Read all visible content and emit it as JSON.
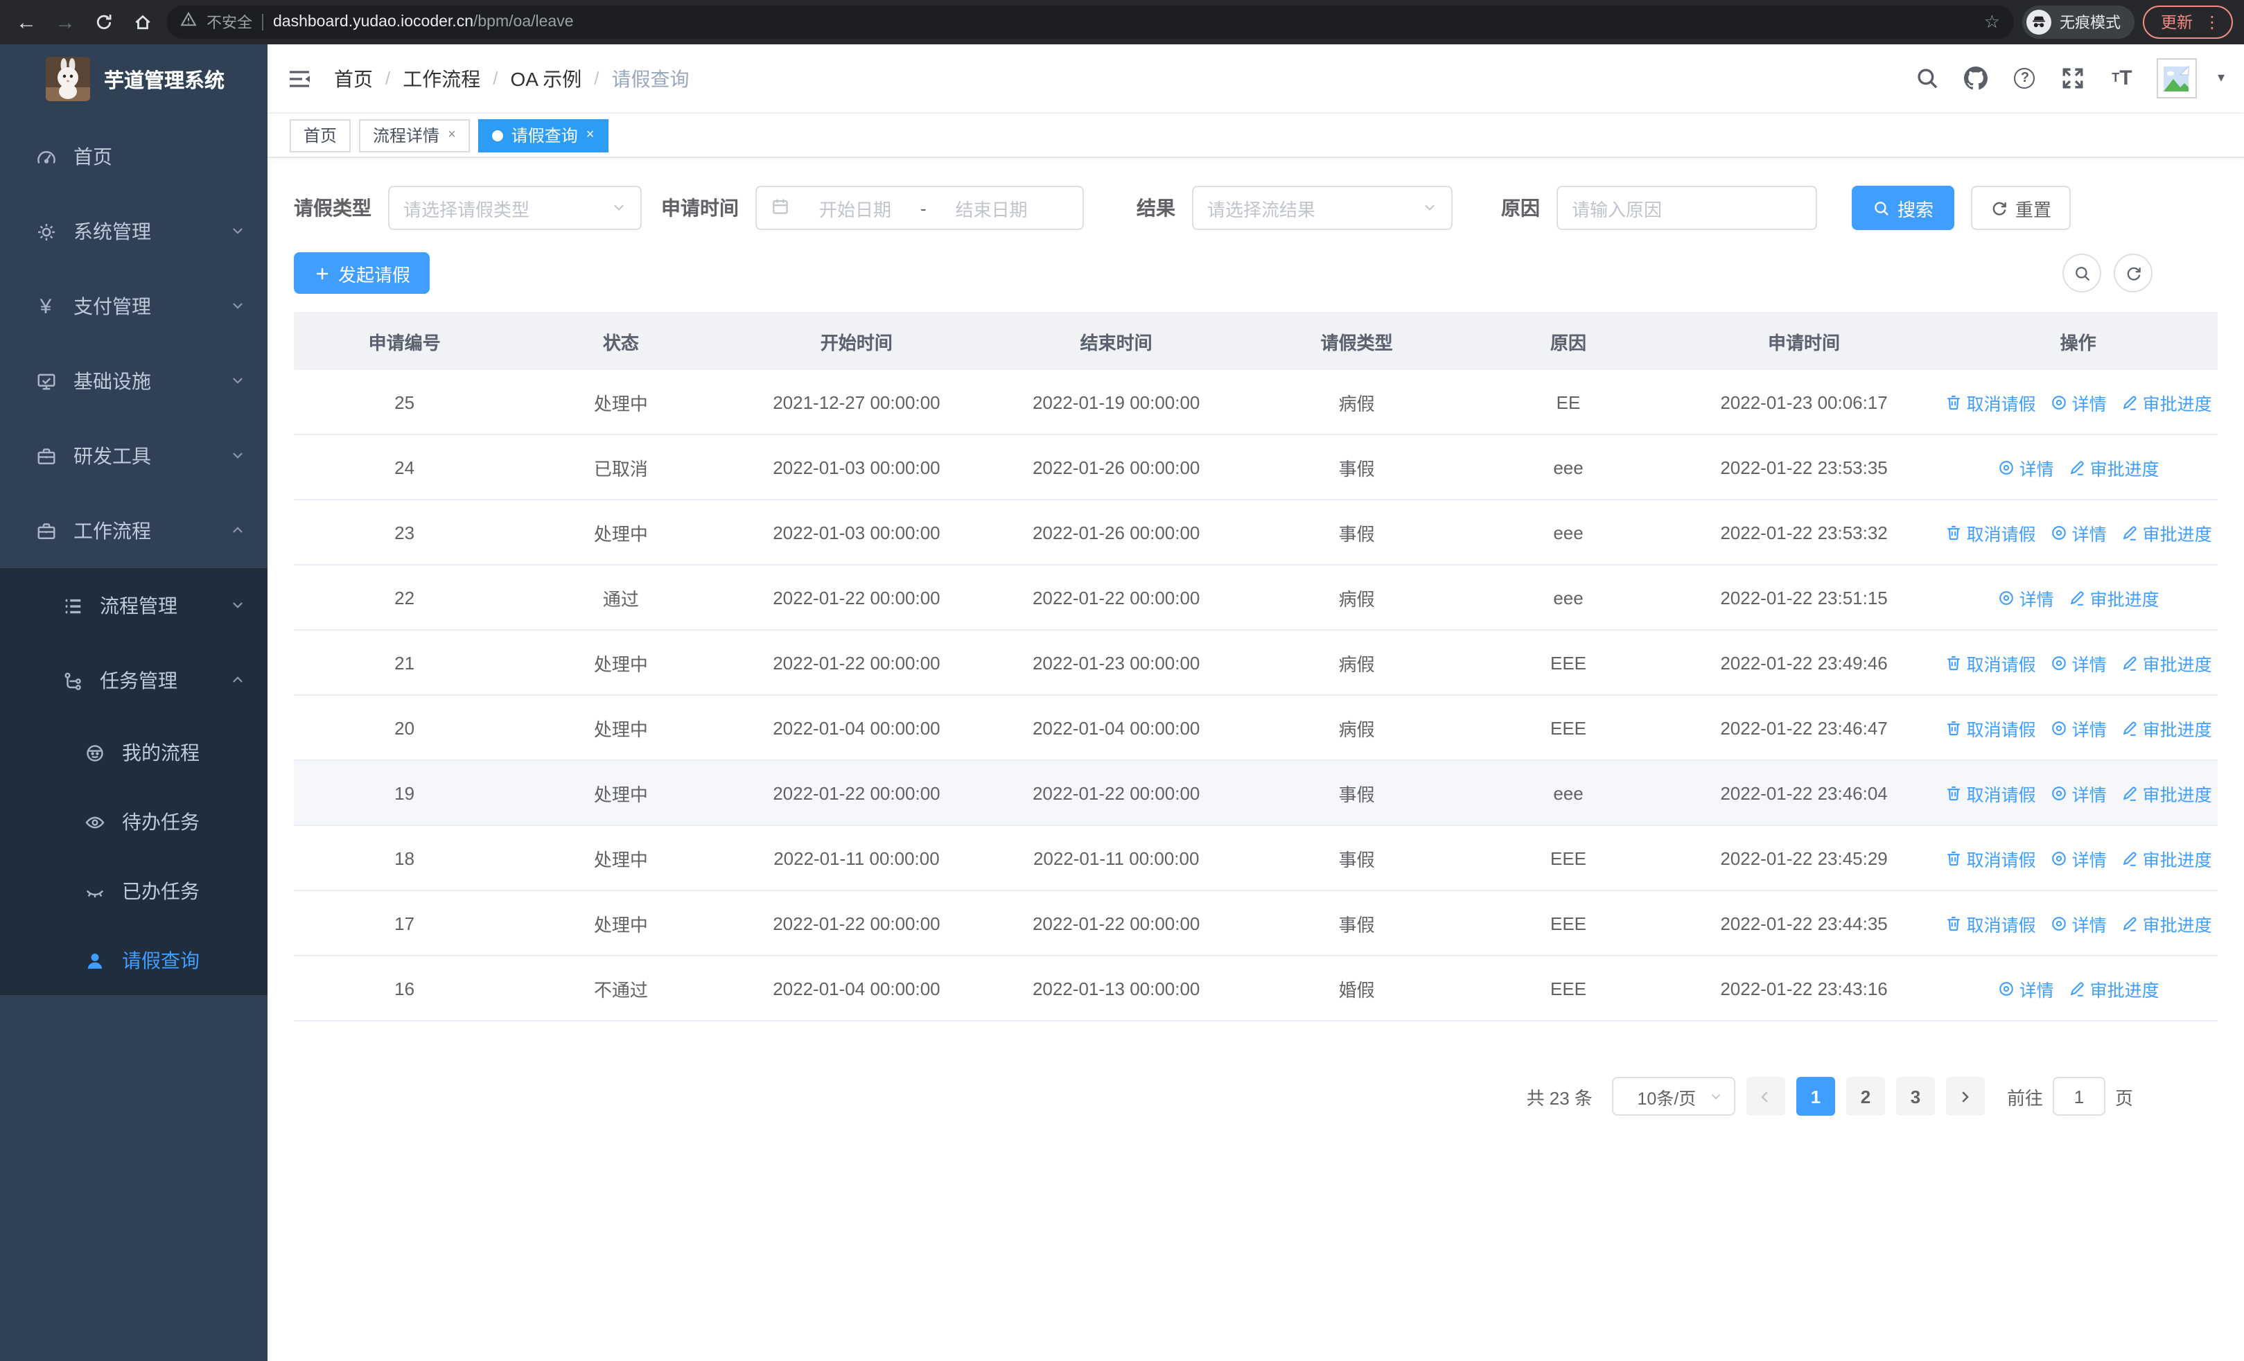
{
  "browser": {
    "security_label": "不安全",
    "url_host": "dashboard.yudao.iocoder.cn",
    "url_path": "/bpm/oa/leave",
    "incognito_label": "无痕模式",
    "update_label": "更新"
  },
  "sidebar": {
    "app_title": "芋道管理系统",
    "items": [
      {
        "key": "home",
        "label": "首页",
        "icon": "dashboard-icon",
        "level": 1,
        "submenu": false,
        "chevron": "",
        "active": false
      },
      {
        "key": "system",
        "label": "系统管理",
        "icon": "gear-icon",
        "level": 1,
        "submenu": false,
        "chevron": "down",
        "active": false
      },
      {
        "key": "pay",
        "label": "支付管理",
        "icon": "yen-icon",
        "level": 1,
        "submenu": false,
        "chevron": "down",
        "active": false
      },
      {
        "key": "infra",
        "label": "基础设施",
        "icon": "monitor-icon",
        "level": 1,
        "submenu": false,
        "chevron": "down",
        "active": false
      },
      {
        "key": "devtool",
        "label": "研发工具",
        "icon": "briefcase-icon",
        "level": 1,
        "submenu": false,
        "chevron": "down",
        "active": false
      },
      {
        "key": "workflow",
        "label": "工作流程",
        "icon": "briefcase-icon",
        "level": 1,
        "submenu": false,
        "chevron": "up",
        "active": false
      },
      {
        "key": "process",
        "label": "流程管理",
        "icon": "list-icon",
        "level": 2,
        "submenu": true,
        "chevron": "down",
        "active": false
      },
      {
        "key": "task",
        "label": "任务管理",
        "icon": "tree-icon",
        "level": 2,
        "submenu": true,
        "chevron": "up",
        "active": false
      },
      {
        "key": "my-process",
        "label": "我的流程",
        "icon": "robot-icon",
        "level": 3,
        "submenu": true,
        "chevron": "",
        "active": false
      },
      {
        "key": "todo-task",
        "label": "待办任务",
        "icon": "eye-icon",
        "level": 3,
        "submenu": true,
        "chevron": "",
        "active": false
      },
      {
        "key": "done-task",
        "label": "已办任务",
        "icon": "eye-closed-icon",
        "level": 3,
        "submenu": true,
        "chevron": "",
        "active": false
      },
      {
        "key": "leave",
        "label": "请假查询",
        "icon": "user-icon",
        "level": 3,
        "submenu": true,
        "chevron": "",
        "active": true
      }
    ]
  },
  "breadcrumb": {
    "items": [
      {
        "label": "首页",
        "current": false
      },
      {
        "label": "工作流程",
        "current": false
      },
      {
        "label": "OA 示例",
        "current": false
      },
      {
        "label": "请假查询",
        "current": true
      }
    ]
  },
  "tabs": [
    {
      "label": "首页",
      "closable": false,
      "active": false
    },
    {
      "label": "流程详情",
      "closable": true,
      "active": false
    },
    {
      "label": "请假查询",
      "closable": true,
      "active": true
    }
  ],
  "filters": {
    "leave_type_label": "请假类型",
    "leave_type_placeholder": "请选择请假类型",
    "apply_time_label": "申请时间",
    "start_date_placeholder": "开始日期",
    "date_separator": "-",
    "end_date_placeholder": "结束日期",
    "result_label": "结果",
    "result_placeholder": "请选择流结果",
    "reason_label": "原因",
    "reason_placeholder": "请输入原因",
    "search_label": "搜索",
    "reset_label": "重置"
  },
  "toolbar": {
    "create_label": "发起请假"
  },
  "table": {
    "columns": [
      "申请编号",
      "状态",
      "开始时间",
      "结束时间",
      "请假类型",
      "原因",
      "申请时间",
      "操作"
    ],
    "action_labels": {
      "cancel": "取消请假",
      "detail": "详情",
      "progress": "审批进度"
    },
    "rows": [
      {
        "id": "25",
        "status": "处理中",
        "start": "2021-12-27 00:00:00",
        "end": "2022-01-19 00:00:00",
        "type": "病假",
        "reason": "EE",
        "applied": "2022-01-23 00:06:17",
        "actions": [
          "cancel",
          "detail",
          "progress"
        ],
        "highlight": false
      },
      {
        "id": "24",
        "status": "已取消",
        "start": "2022-01-03 00:00:00",
        "end": "2022-01-26 00:00:00",
        "type": "事假",
        "reason": "eee",
        "applied": "2022-01-22 23:53:35",
        "actions": [
          "detail",
          "progress"
        ],
        "highlight": false
      },
      {
        "id": "23",
        "status": "处理中",
        "start": "2022-01-03 00:00:00",
        "end": "2022-01-26 00:00:00",
        "type": "事假",
        "reason": "eee",
        "applied": "2022-01-22 23:53:32",
        "actions": [
          "cancel",
          "detail",
          "progress"
        ],
        "highlight": false
      },
      {
        "id": "22",
        "status": "通过",
        "start": "2022-01-22 00:00:00",
        "end": "2022-01-22 00:00:00",
        "type": "病假",
        "reason": "eee",
        "applied": "2022-01-22 23:51:15",
        "actions": [
          "detail",
          "progress"
        ],
        "highlight": false
      },
      {
        "id": "21",
        "status": "处理中",
        "start": "2022-01-22 00:00:00",
        "end": "2022-01-23 00:00:00",
        "type": "病假",
        "reason": "EEE",
        "applied": "2022-01-22 23:49:46",
        "actions": [
          "cancel",
          "detail",
          "progress"
        ],
        "highlight": false
      },
      {
        "id": "20",
        "status": "处理中",
        "start": "2022-01-04 00:00:00",
        "end": "2022-01-04 00:00:00",
        "type": "病假",
        "reason": "EEE",
        "applied": "2022-01-22 23:46:47",
        "actions": [
          "cancel",
          "detail",
          "progress"
        ],
        "highlight": false
      },
      {
        "id": "19",
        "status": "处理中",
        "start": "2022-01-22 00:00:00",
        "end": "2022-01-22 00:00:00",
        "type": "事假",
        "reason": "eee",
        "applied": "2022-01-22 23:46:04",
        "actions": [
          "cancel",
          "detail",
          "progress"
        ],
        "highlight": true
      },
      {
        "id": "18",
        "status": "处理中",
        "start": "2022-01-11 00:00:00",
        "end": "2022-01-11 00:00:00",
        "type": "事假",
        "reason": "EEE",
        "applied": "2022-01-22 23:45:29",
        "actions": [
          "cancel",
          "detail",
          "progress"
        ],
        "highlight": false
      },
      {
        "id": "17",
        "status": "处理中",
        "start": "2022-01-22 00:00:00",
        "end": "2022-01-22 00:00:00",
        "type": "事假",
        "reason": "EEE",
        "applied": "2022-01-22 23:44:35",
        "actions": [
          "cancel",
          "detail",
          "progress"
        ],
        "highlight": false
      },
      {
        "id": "16",
        "status": "不通过",
        "start": "2022-01-04 00:00:00",
        "end": "2022-01-13 00:00:00",
        "type": "婚假",
        "reason": "EEE",
        "applied": "2022-01-22 23:43:16",
        "actions": [
          "detail",
          "progress"
        ],
        "highlight": false
      }
    ]
  },
  "pagination": {
    "total_label": "共 23 条",
    "page_size_label": "10条/页",
    "pages": [
      "1",
      "2",
      "3"
    ],
    "active_page": "1",
    "goto_label": "前往",
    "goto_value": "1",
    "page_unit_label": "页"
  }
}
